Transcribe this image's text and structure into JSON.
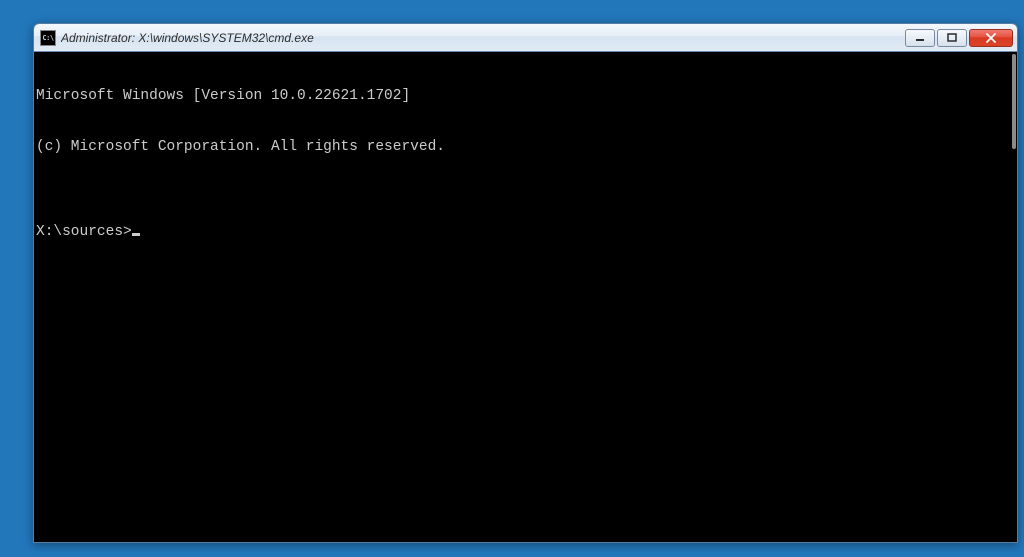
{
  "titlebar": {
    "icon_text": "C:\\",
    "title": "Administrator: X:\\windows\\SYSTEM32\\cmd.exe"
  },
  "terminal": {
    "line1": "Microsoft Windows [Version 10.0.22621.1702]",
    "line2": "(c) Microsoft Corporation. All rights reserved.",
    "blank": "",
    "prompt": "X:\\sources>"
  }
}
